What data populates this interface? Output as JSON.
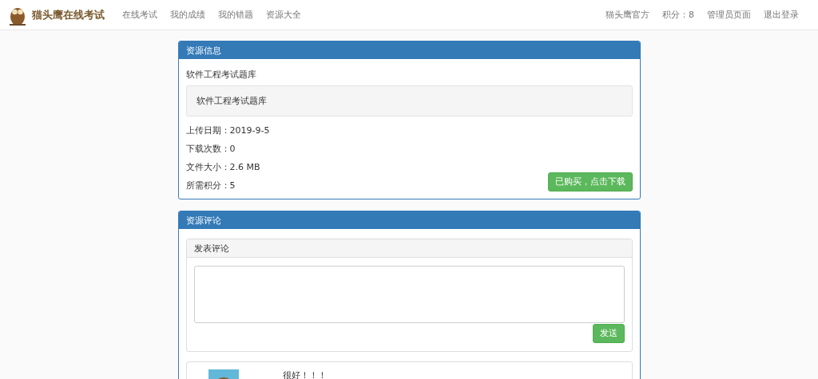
{
  "navbar": {
    "brand": "猫头鹰在线考试",
    "links": [
      "在线考试",
      "我的成绩",
      "我的错题",
      "资源大全"
    ],
    "right_links": [
      "猫头鹰官方",
      "积分：8",
      "管理员页面",
      "退出登录"
    ]
  },
  "resource_panel": {
    "title": "资源信息",
    "name": "软件工程考试题库",
    "description": "软件工程考试题库",
    "details": [
      "上传日期：2019-9-5",
      "下载次数：0",
      "文件大小：2.6 MB",
      "所需积分：5"
    ],
    "download_button": "已购买，点击下载"
  },
  "comments_panel": {
    "title": "资源评论",
    "form_title": "发表评论",
    "send_button": "发送",
    "comments": [
      {
        "text": "很好！！！"
      }
    ]
  }
}
